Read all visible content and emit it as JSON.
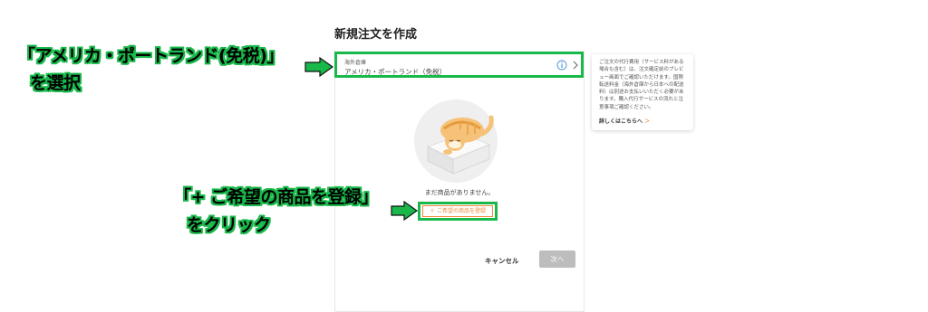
{
  "form": {
    "title": "新規注文を作成",
    "warehouse_label": "海外倉庫",
    "warehouse_value": "アメリカ・ポートランド（免税）",
    "empty_message": "まだ商品がありません。",
    "add_item_label": "＋ ご希望の商品を登録",
    "cancel_label": "キャンセル",
    "next_label": "次へ"
  },
  "note": {
    "text": "ご注文の代行費用（サービス料がある場合も含む）は、注文確定前のプレビュー画面でご確認いただけます。国際転送料金（海外倉庫から日本への配送料）は別途お支払いいただく必要があります。購入代行サービスの流れと注意事項ご確認ください。",
    "link_label": "詳しくはこちらへ",
    "link_arrow": "＞"
  },
  "annotations": {
    "step1_line1": "「アメリカ・ポートランド(免税)」",
    "step1_line2": "を選択",
    "step2_line1": "「+ ご希望の商品を登録」",
    "step2_line2": "をクリック"
  },
  "colors": {
    "highlight": "#19b84a",
    "accent": "#f08a3a",
    "disabled_button": "#bdbdbd"
  },
  "icons": {
    "info": "info-icon",
    "chevron": "chevron-right-icon",
    "arrow": "green-arrow-icon",
    "illustration": "sleeping-cat-illustration"
  }
}
